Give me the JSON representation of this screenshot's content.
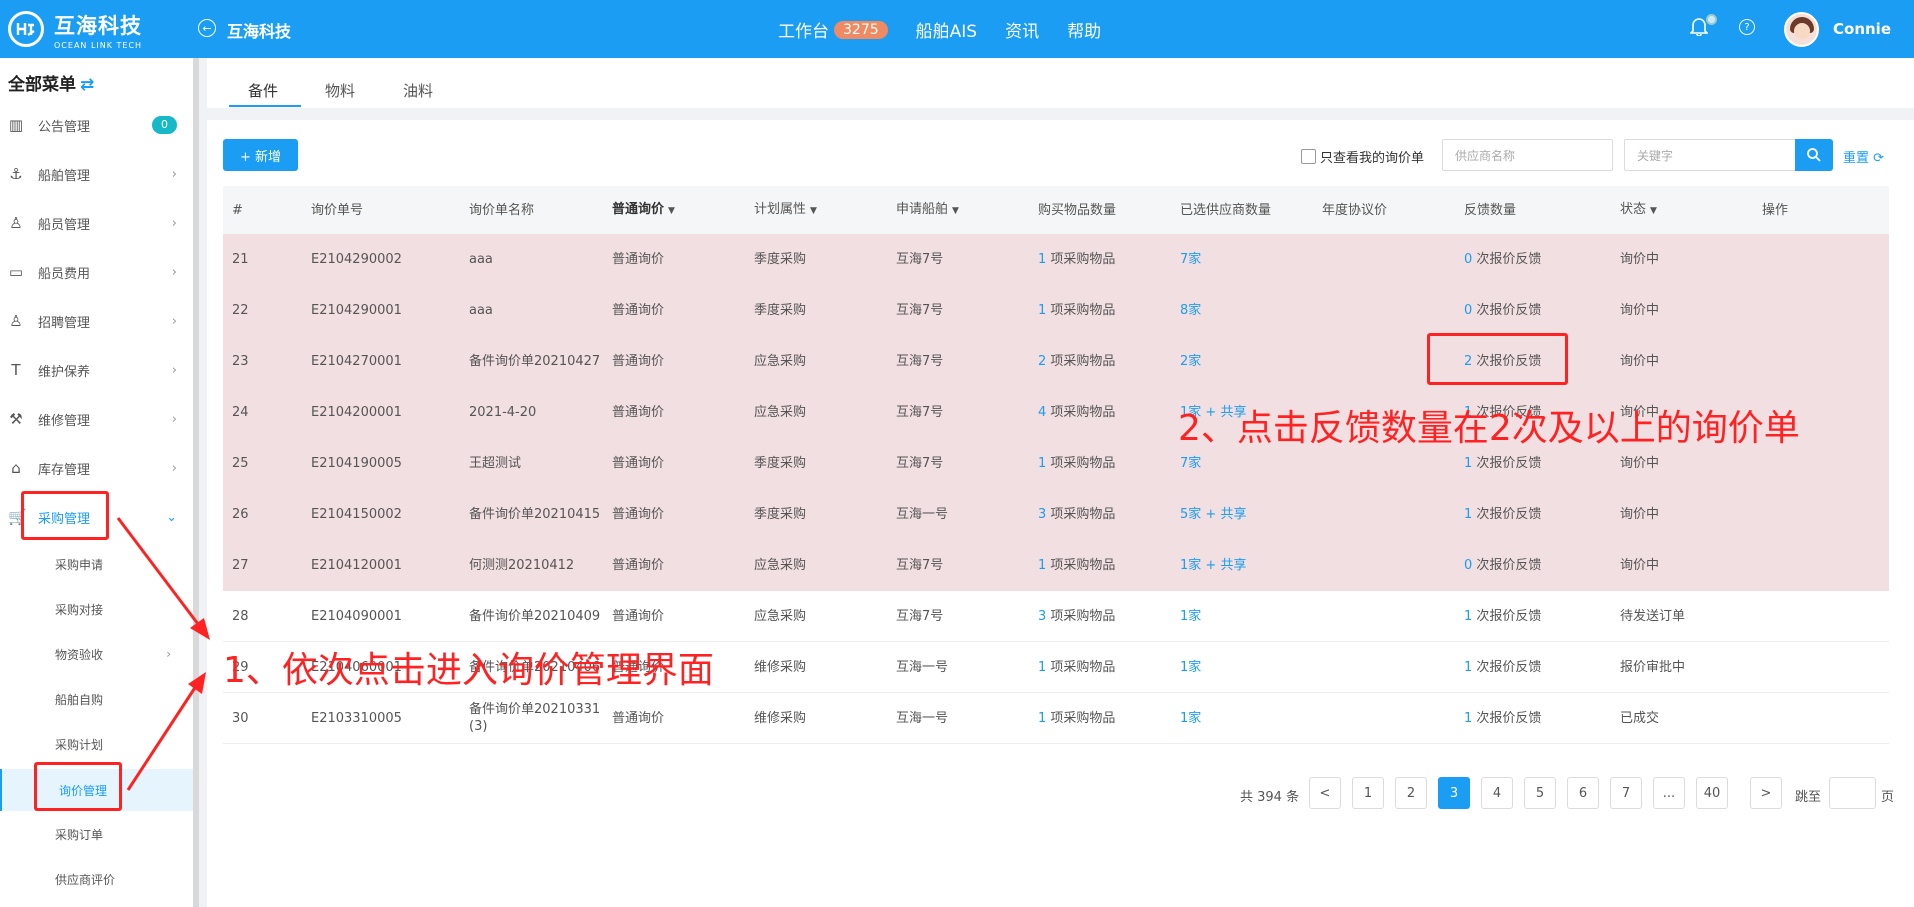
{
  "header": {
    "brand_cn": "互海科技",
    "brand_en": "OCEAN LINK TECH",
    "company": "互海科技",
    "nav": [
      {
        "label": "工作台",
        "badge": "3275"
      },
      {
        "label": "船舶AIS"
      },
      {
        "label": "资讯"
      },
      {
        "label": "帮助"
      }
    ],
    "username": "Connie"
  },
  "sidebar": {
    "title": "全部菜单",
    "items": [
      {
        "label": "公告管理",
        "icon": "book-icon",
        "badge": "0"
      },
      {
        "label": "船舶管理",
        "icon": "anchor-icon"
      },
      {
        "label": "船员管理",
        "icon": "user-icon"
      },
      {
        "label": "船员费用",
        "icon": "wallet-icon"
      },
      {
        "label": "招聘管理",
        "icon": "recruit-icon"
      },
      {
        "label": "维护保养",
        "icon": "hammer-icon"
      },
      {
        "label": "维修管理",
        "icon": "wrench-icon"
      },
      {
        "label": "库存管理",
        "icon": "home-icon"
      },
      {
        "label": "采购管理",
        "icon": "cart-icon"
      }
    ],
    "sub_items": [
      {
        "label": "采购申请"
      },
      {
        "label": "采购对接"
      },
      {
        "label": "物资验收"
      },
      {
        "label": "船舶自购"
      },
      {
        "label": "采购计划"
      },
      {
        "label": "询价管理"
      },
      {
        "label": "采购订单"
      },
      {
        "label": "供应商评价"
      }
    ]
  },
  "tabs": [
    "备件",
    "物料",
    "油料"
  ],
  "toolbar": {
    "add_label": "+ 新增",
    "only_mine_label": "只查看我的询价单",
    "supplier_placeholder": "供应商名称",
    "keyword_placeholder": "关键字",
    "reset_label": "重置"
  },
  "table": {
    "headers": [
      "#",
      "询价单号",
      "询价单名称",
      "普通询价",
      "计划属性",
      "申请船舶",
      "购买物品数量",
      "已选供应商数量",
      "年度协议价",
      "反馈数量",
      "状态",
      "操作"
    ],
    "rows": [
      {
        "no": "21",
        "code": "E2104290002",
        "name": "aaa",
        "type": "普通询价",
        "plan": "季度采购",
        "ship": "互海7号",
        "qty_n": "1",
        "qty_t": " 项采购物品",
        "sup": "7家",
        "sup_share": "",
        "annual": "",
        "fb_n": "0",
        "fb_t": " 次报价反馈",
        "status": "询价中"
      },
      {
        "no": "22",
        "code": "E2104290001",
        "name": "aaa",
        "type": "普通询价",
        "plan": "季度采购",
        "ship": "互海7号",
        "qty_n": "1",
        "qty_t": " 项采购物品",
        "sup": "8家",
        "sup_share": "",
        "annual": "",
        "fb_n": "0",
        "fb_t": " 次报价反馈",
        "status": "询价中"
      },
      {
        "no": "23",
        "code": "E2104270001",
        "name": "备件询价单20210427",
        "type": "普通询价",
        "plan": "应急采购",
        "ship": "互海7号",
        "qty_n": "2",
        "qty_t": " 项采购物品",
        "sup": "2家",
        "sup_share": "",
        "annual": "",
        "fb_n": "2",
        "fb_t": " 次报价反馈",
        "status": "询价中"
      },
      {
        "no": "24",
        "code": "E2104200001",
        "name": "2021-4-20",
        "type": "普通询价",
        "plan": "应急采购",
        "ship": "互海7号",
        "qty_n": "4",
        "qty_t": " 项采购物品",
        "sup": "1家",
        "sup_share": " + 共享",
        "annual": "",
        "fb_n": "1",
        "fb_t": " 次报价反馈",
        "status": "询价中"
      },
      {
        "no": "25",
        "code": "E2104190005",
        "name": "王超测试",
        "type": "普通询价",
        "plan": "季度采购",
        "ship": "互海7号",
        "qty_n": "1",
        "qty_t": " 项采购物品",
        "sup": "7家",
        "sup_share": "",
        "annual": "",
        "fb_n": "1",
        "fb_t": " 次报价反馈",
        "status": "询价中"
      },
      {
        "no": "26",
        "code": "E2104150002",
        "name": "备件询价单20210415",
        "type": "普通询价",
        "plan": "季度采购",
        "ship": "互海一号",
        "qty_n": "3",
        "qty_t": " 项采购物品",
        "sup": "5家",
        "sup_share": " + 共享",
        "annual": "",
        "fb_n": "1",
        "fb_t": " 次报价反馈",
        "status": "询价中"
      },
      {
        "no": "27",
        "code": "E2104120001",
        "name": "何测测20210412",
        "type": "普通询价",
        "plan": "应急采购",
        "ship": "互海7号",
        "qty_n": "1",
        "qty_t": " 项采购物品",
        "sup": "1家",
        "sup_share": " + 共享",
        "annual": "",
        "fb_n": "0",
        "fb_t": " 次报价反馈",
        "status": "询价中"
      },
      {
        "no": "28",
        "code": "E2104090001",
        "name": "备件询价单20210409",
        "type": "普通询价",
        "plan": "应急采购",
        "ship": "互海7号",
        "qty_n": "3",
        "qty_t": " 项采购物品",
        "sup": "1家",
        "sup_share": "",
        "annual": "",
        "fb_n": "1",
        "fb_t": " 次报价反馈",
        "status": "待发送订单"
      },
      {
        "no": "29",
        "code": "E2104060001",
        "name": "备件询价单20210406",
        "type": "普通询价",
        "plan": "维修采购",
        "ship": "互海一号",
        "qty_n": "1",
        "qty_t": " 项采购物品",
        "sup": "1家",
        "sup_share": "",
        "annual": "",
        "fb_n": "1",
        "fb_t": " 次报价反馈",
        "status": "报价审批中"
      },
      {
        "no": "30",
        "code": "E2103310005",
        "name": "备件询价单20210331(3)",
        "type": "普通询价",
        "plan": "维修采购",
        "ship": "互海一号",
        "qty_n": "1",
        "qty_t": " 项采购物品",
        "sup": "1家",
        "sup_share": "",
        "annual": "",
        "fb_n": "1",
        "fb_t": " 次报价反馈",
        "status": "已成交"
      }
    ]
  },
  "pagination": {
    "total": "共 394 条",
    "prev": "<",
    "pages": [
      "1",
      "2",
      "3",
      "4",
      "5",
      "6",
      "7",
      "...",
      "40"
    ],
    "current": "3",
    "next": ">",
    "jump": "跳至",
    "page_unit": "页"
  },
  "annotations": {
    "step1": "1、依次点击进入询价管理界面",
    "step2": "2、点击反馈数量在2次及以上的询价单"
  },
  "colors": {
    "primary": "#1a9df2",
    "annotation": "#ff2222",
    "row_highlight": "#f2dfe1"
  }
}
